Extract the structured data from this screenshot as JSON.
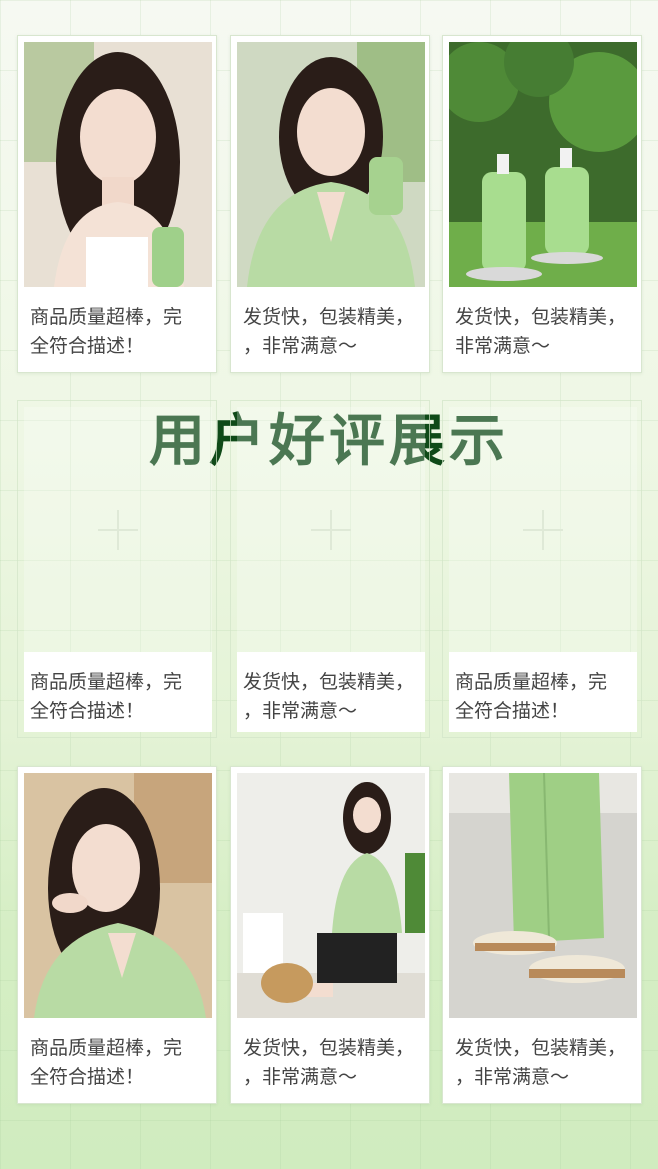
{
  "title": "用户好评展示",
  "reviews": [
    {
      "caption": "商品质量超棒，完\n全符合描述！",
      "photo": "woman-holding-green-cup"
    },
    {
      "caption": "发货快，包装精美，\n，非常满意～",
      "photo": "woman-green-blazer-holding-cup"
    },
    {
      "caption": "发货快，包装精美，\n非常满意～",
      "photo": "green-shampoo-bottles"
    },
    {
      "caption": "商品质量超棒，完\n全符合描述！",
      "photo": "empty"
    },
    {
      "caption": "发货快，包装精美，\n，非常满意～",
      "photo": "empty"
    },
    {
      "caption": "商品质量超棒，完\n全符合描述！",
      "photo": "empty"
    },
    {
      "caption": "商品质量超棒，完\n全符合描述！",
      "photo": "woman-portrait-green-shirt"
    },
    {
      "caption": "发货快，包装精美，\n，非常满意～",
      "photo": "woman-seated-green-jacket"
    },
    {
      "caption": "发货快，包装精美，\n，非常满意～",
      "photo": "green-pants-sneakers"
    }
  ],
  "colors": {
    "title": "#0f4a18",
    "accent_green": "#9fd08a",
    "caption_text": "#444444"
  }
}
